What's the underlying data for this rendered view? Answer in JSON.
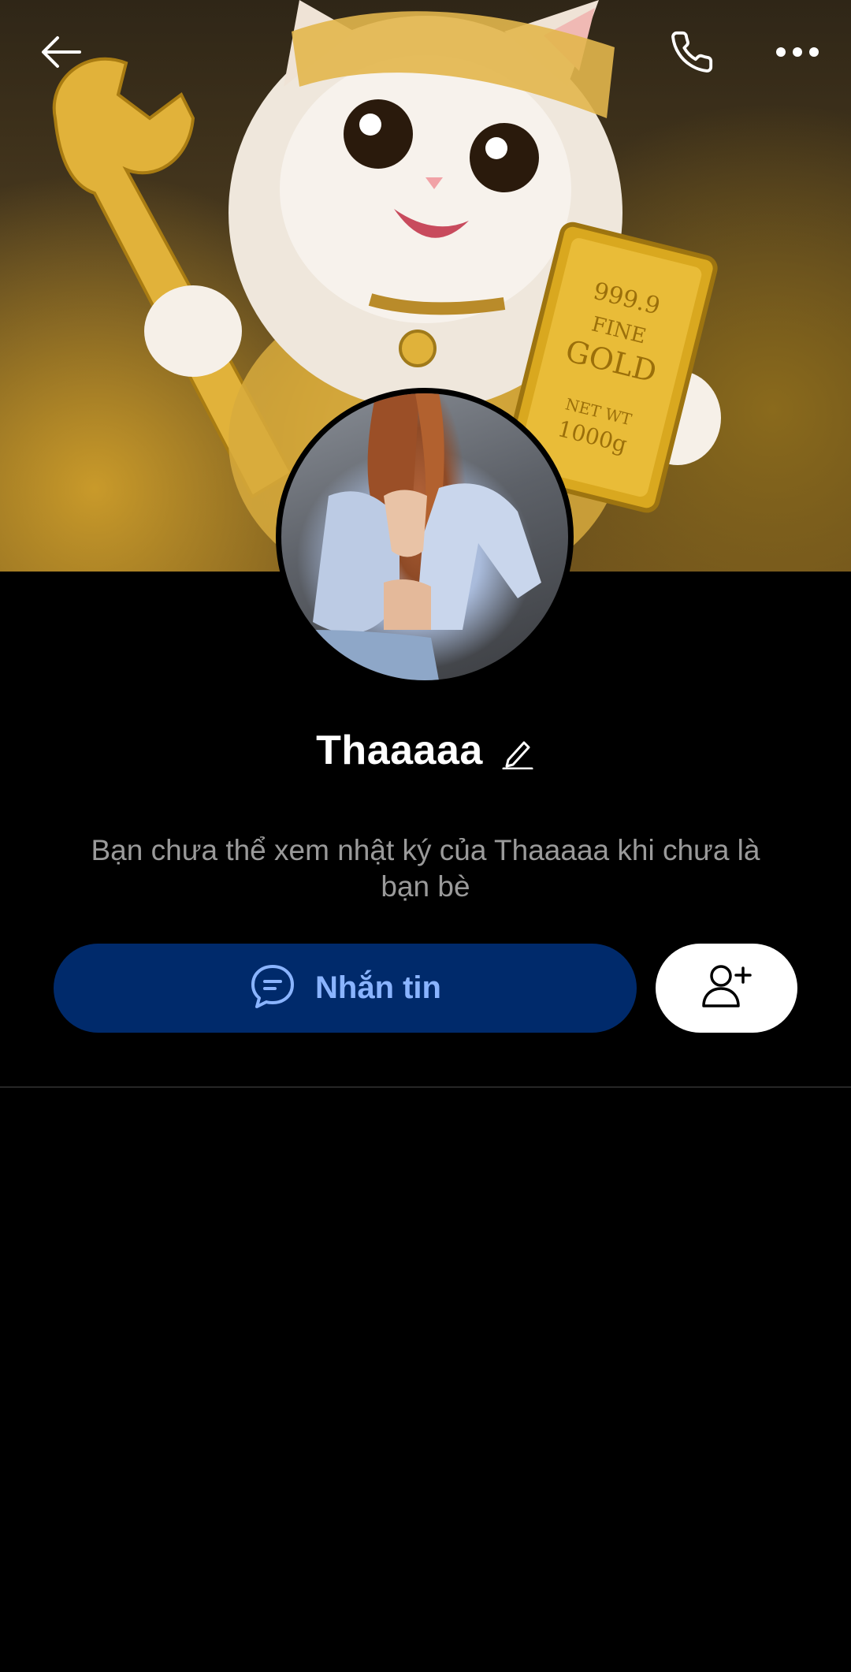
{
  "profile": {
    "name": "Thaaaaa",
    "privacy_notice": "Bạn chưa thể xem nhật ký của Thaaaaa khi chưa là bạn bè"
  },
  "header": {
    "back_icon": "arrow-left-icon",
    "call_icon": "phone-icon",
    "more_icon": "more-horizontal-icon"
  },
  "actions": {
    "message_label": "Nhắn tin",
    "message_icon": "chat-bubble-icon",
    "add_friend_icon": "user-plus-icon"
  },
  "colors": {
    "background": "#000000",
    "message_button_bg": "#002a6b",
    "message_button_text": "#8ab4ff",
    "secondary_text": "#9a9a9a",
    "add_friend_button_bg": "#ffffff"
  }
}
